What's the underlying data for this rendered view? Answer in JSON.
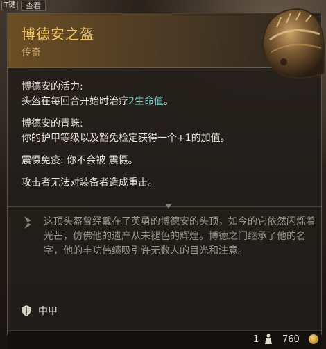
{
  "topbar": {
    "key_label": "T键",
    "view_label": "查看"
  },
  "item": {
    "name": "博德安之盔",
    "rarity": "传奇"
  },
  "effects": [
    {
      "title": "博德安的活力:",
      "text_before": "头盔在每回合开始时治疗",
      "highlight": "2生命值",
      "text_after": "。"
    },
    {
      "title": "博德安的青睐:",
      "text": "你的护甲等级以及豁免检定获得一个+1的加值。"
    },
    {
      "inline": "震慑免疫: 你不会被 震慑。"
    },
    {
      "inline": "攻击者无法对装备者造成重击。"
    }
  ],
  "lore": "这顶头盔曾经戴在了英勇的博德安的头顶，如今的它依然闪烁着光芒，仿佛他的遗产从未褪色的辉煌。博德之门继承了他的名字，他的丰功伟绩吸引许无数人的目光和注意。",
  "armor_type": "中甲",
  "footer": {
    "weight": "1",
    "price": "760"
  },
  "colors": {
    "title_gold": "#f0c867",
    "rarity": "#c8a066",
    "highlight_teal": "#7fc8c4",
    "lore_gray": "#9c948a"
  },
  "icons": [
    "helmet-icon",
    "quill-icon",
    "shield-icon",
    "weight-icon",
    "coin-icon"
  ]
}
